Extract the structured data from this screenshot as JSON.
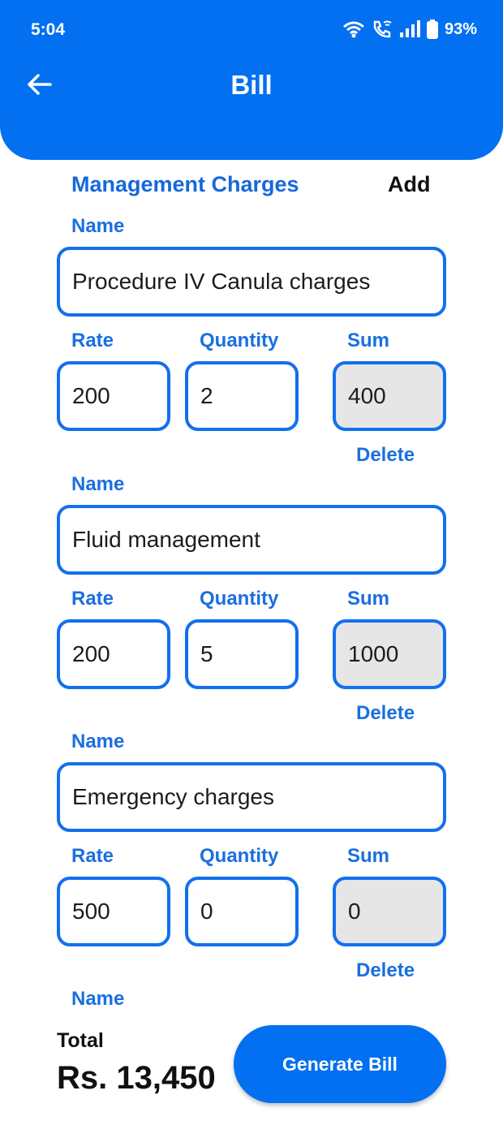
{
  "status_bar": {
    "time": "5:04",
    "battery": "93%"
  },
  "header": {
    "title": "Bill"
  },
  "section": {
    "title": "Management Charges",
    "add_label": "Add"
  },
  "labels": {
    "name": "Name",
    "rate": "Rate",
    "quantity": "Quantity",
    "sum": "Sum",
    "delete": "Delete"
  },
  "items": [
    {
      "name": "Procedure IV Canula charges",
      "rate": "200",
      "quantity": "2",
      "sum": "400"
    },
    {
      "name": "Fluid management",
      "rate": "200",
      "quantity": "5",
      "sum": "1000"
    },
    {
      "name": "Emergency charges",
      "rate": "500",
      "quantity": "0",
      "sum": "0"
    }
  ],
  "footer": {
    "total_label": "Total",
    "total_value": "Rs. 13,450",
    "generate_label": "Generate Bill"
  },
  "colors": {
    "primary": "#0270f0",
    "label": "#1a6fe0",
    "field_border": "#1170ee",
    "readonly_bg": "#e6e6e6"
  }
}
